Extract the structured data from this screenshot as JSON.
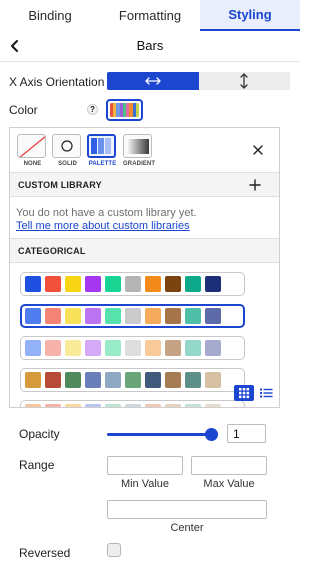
{
  "tabs": [
    {
      "label": "Binding",
      "active": false
    },
    {
      "label": "Formatting",
      "active": false
    },
    {
      "label": "Styling",
      "active": true
    }
  ],
  "header": {
    "title": "Bars",
    "back_icon": "chevron-left-icon"
  },
  "axis_orientation": {
    "label": "X Axis Orientation",
    "options": [
      {
        "icon": "horizontal-arrows-icon",
        "selected": true
      },
      {
        "icon": "vertical-arrows-icon",
        "selected": false
      }
    ]
  },
  "color": {
    "label": "Color",
    "help_text": "?",
    "swatch_colors": [
      "#e7523c",
      "#f6b13c",
      "#6d9be7",
      "#9b5ed8",
      "#4cbf8a",
      "#e86aa3",
      "#f28a2e",
      "#3a6fd8",
      "#c6d04a"
    ]
  },
  "color_panel": {
    "types": [
      {
        "label": "NONE",
        "icon": "none-slash-icon",
        "selected": false
      },
      {
        "label": "SOLID",
        "icon": "circle-icon",
        "selected": false
      },
      {
        "label": "PALETTE",
        "icon": "palette-bars-icon",
        "selected": true
      },
      {
        "label": "GRADIENT",
        "icon": "gradient-icon",
        "selected": false
      }
    ],
    "custom_library": {
      "title": "CUSTOM LIBRARY",
      "empty_text": "You do not have a custom library yet.",
      "link_text": "Tell me more about custom libraries"
    },
    "categorical_title": "CATEGORICAL",
    "palettes": [
      {
        "selected": false,
        "colors": [
          "#1f4fe0",
          "#f1503a",
          "#f7d414",
          "#a437ef",
          "#19d392",
          "#b5b5b5",
          "#f38a1c",
          "#7a4310",
          "#0ba989",
          "#1e2f7a"
        ]
      },
      {
        "selected": true,
        "colors": [
          "#4f7df0",
          "#f48576",
          "#f7e05a",
          "#bd74f3",
          "#57e1ad",
          "#cbcbcb",
          "#f6aa5b",
          "#a7754a",
          "#4fbfa8",
          "#5f6aa8"
        ]
      },
      {
        "selected": false,
        "colors": [
          "#93b1f6",
          "#f7b2a9",
          "#f9eb98",
          "#d6a9f7",
          "#98ecca",
          "#dedede",
          "#f9cb9b",
          "#c7a386",
          "#93d8c9",
          "#a6abce"
        ]
      },
      {
        "selected": false,
        "colors": [
          "#d69a3a",
          "#b84a3a",
          "#4f8a5c",
          "#6a7fba",
          "#8ea7c2",
          "#6aa57a",
          "#3f5a7a",
          "#a67c55",
          "#5c8f8a",
          "#d6c0a4"
        ]
      },
      {
        "selected": false,
        "colors": [
          "#f6c79e",
          "#f3b3a6",
          "#f5d7a2",
          "#b8c6f0",
          "#bfe3d0",
          "#cfd7e0",
          "#f0c9b8",
          "#e6d3bf",
          "#c6e1d8",
          "#e6dcd0"
        ]
      }
    ],
    "view_icons": [
      "grid-view-icon",
      "list-view-icon"
    ]
  },
  "opacity": {
    "label": "Opacity",
    "value": "1",
    "slider_fraction": 1.0
  },
  "range": {
    "label": "Range",
    "min_label": "Min Value",
    "max_label": "Max Value",
    "center_label": "Center",
    "min_value": "",
    "max_value": "",
    "center_value": ""
  },
  "reversed": {
    "label": "Reversed",
    "checked": false
  }
}
